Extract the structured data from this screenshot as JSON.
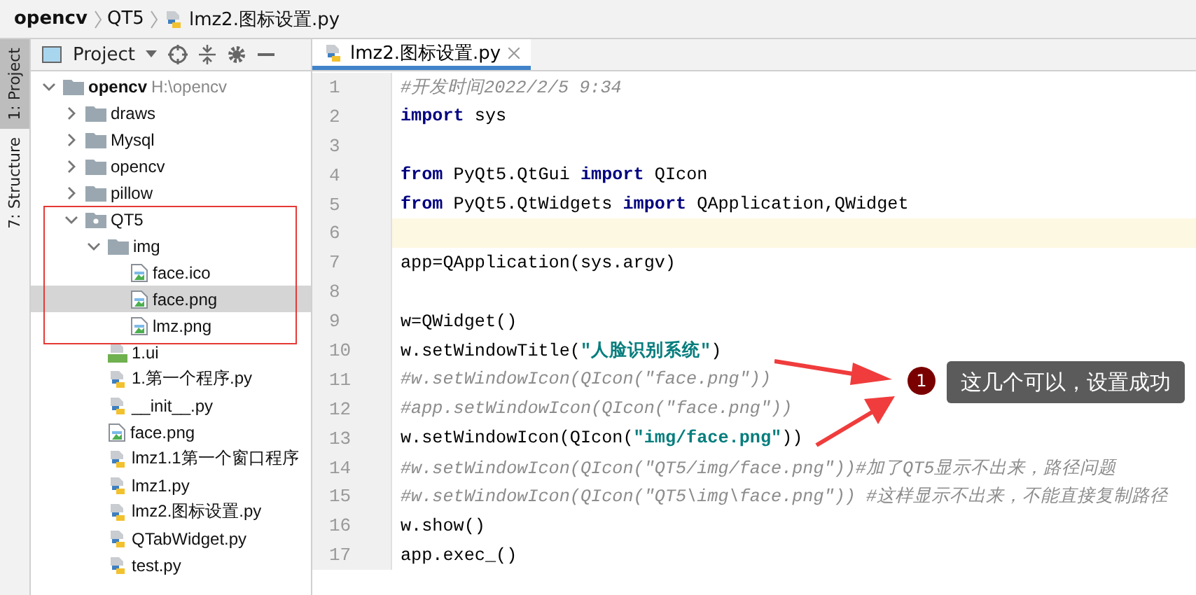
{
  "breadcrumb": [
    {
      "label": "opencv",
      "kind": "project"
    },
    {
      "label": "QT5",
      "kind": "folder"
    },
    {
      "label": "lmz2.图标设置.py",
      "kind": "file"
    }
  ],
  "tool_strip": [
    {
      "label": "1: Project",
      "selected": true
    },
    {
      "label": "7: Structure",
      "selected": false
    }
  ],
  "project_panel": {
    "title": "Project",
    "tree": [
      {
        "label": "opencv",
        "hint": "H:\\opencv",
        "kind": "root",
        "expanded": true,
        "selected": false,
        "children": [
          {
            "label": "draws",
            "kind": "folder",
            "expanded": false,
            "selected": false
          },
          {
            "label": "Mysql",
            "kind": "folder",
            "expanded": false,
            "selected": false
          },
          {
            "label": "opencv",
            "kind": "folder",
            "expanded": false,
            "selected": false
          },
          {
            "label": "pillow",
            "kind": "folder",
            "expanded": false,
            "selected": false
          },
          {
            "label": "QT5",
            "kind": "package",
            "expanded": true,
            "selected": false,
            "children": [
              {
                "label": "img",
                "kind": "folder",
                "expanded": true,
                "selected": false,
                "children": [
                  {
                    "label": "face.ico",
                    "kind": "image",
                    "selected": false
                  },
                  {
                    "label": "face.png",
                    "kind": "image",
                    "selected": true
                  },
                  {
                    "label": "lmz.png",
                    "kind": "image",
                    "selected": false
                  }
                ]
              },
              {
                "label": "1.ui",
                "kind": "ui",
                "selected": false
              },
              {
                "label": "1.第一个程序.py",
                "kind": "py",
                "selected": false
              },
              {
                "label": "__init__.py",
                "kind": "py",
                "selected": false
              },
              {
                "label": "face.png",
                "kind": "image",
                "selected": false
              },
              {
                "label": "lmz1.1第一个窗口程序",
                "kind": "py",
                "selected": false
              },
              {
                "label": "lmz1.py",
                "kind": "py",
                "selected": false
              },
              {
                "label": "lmz2.图标设置.py",
                "kind": "py",
                "selected": false
              },
              {
                "label": "QTabWidget.py",
                "kind": "py",
                "selected": false
              },
              {
                "label": "test.py",
                "kind": "py",
                "selected": false
              }
            ]
          }
        ]
      }
    ]
  },
  "editor": {
    "tabs": [
      {
        "label": "lmz2.图标设置.py",
        "selected": true
      }
    ],
    "lines": [
      {
        "number": "1",
        "current": false,
        "tokens": [
          {
            "kind": "comment",
            "text": "#开发时间2022/2/5 9:34"
          }
        ]
      },
      {
        "number": "2",
        "current": false,
        "tokens": [
          {
            "kind": "keyword",
            "text": "import"
          },
          {
            "kind": "plain",
            "text": " sys"
          }
        ]
      },
      {
        "number": "3",
        "current": false
      },
      {
        "number": "4",
        "current": false,
        "tokens": [
          {
            "kind": "keyword",
            "text": "from"
          },
          {
            "kind": "plain",
            "text": " PyQt5.QtGui "
          },
          {
            "kind": "keyword",
            "text": "import"
          },
          {
            "kind": "plain",
            "text": " QIcon"
          }
        ]
      },
      {
        "number": "5",
        "current": false,
        "tokens": [
          {
            "kind": "keyword",
            "text": "from"
          },
          {
            "kind": "plain",
            "text": " PyQt5.QtWidgets "
          },
          {
            "kind": "keyword",
            "text": "import"
          },
          {
            "kind": "plain",
            "text": " QApplication,QWidget"
          }
        ]
      },
      {
        "number": "6",
        "current": true
      },
      {
        "number": "7",
        "current": false,
        "tokens": [
          {
            "kind": "plain",
            "text": "app=QApplication(sys.argv)"
          }
        ]
      },
      {
        "number": "8",
        "current": false
      },
      {
        "number": "9",
        "current": false,
        "tokens": [
          {
            "kind": "plain",
            "text": "w=QWidget()"
          }
        ]
      },
      {
        "number": "10",
        "current": false,
        "tokens": [
          {
            "kind": "plain",
            "text": "w.setWindowTitle("
          },
          {
            "kind": "string",
            "text": "\"人脸识别系统\""
          },
          {
            "kind": "plain",
            "text": ")"
          }
        ]
      },
      {
        "number": "11",
        "current": false,
        "tokens": [
          {
            "kind": "comment",
            "text": "#w.setWindowIcon(QIcon(\"face.png\"))"
          }
        ]
      },
      {
        "number": "12",
        "current": false,
        "tokens": [
          {
            "kind": "comment",
            "text": "#app.setWindowIcon(QIcon(\"face.png\"))"
          }
        ]
      },
      {
        "number": "13",
        "current": false,
        "tokens": [
          {
            "kind": "plain",
            "text": "w.setWindowIcon(QIcon("
          },
          {
            "kind": "string",
            "text": "\"img/face.png\""
          },
          {
            "kind": "plain",
            "text": "))"
          }
        ]
      },
      {
        "number": "14",
        "current": false,
        "tokens": [
          {
            "kind": "comment",
            "text": "#w.setWindowIcon(QIcon(\"QT5/img/face.png\"))#加了QT5显示不出来，路径问题"
          }
        ]
      },
      {
        "number": "15",
        "current": false,
        "tokens": [
          {
            "kind": "comment",
            "text": "#w.setWindowIcon(QIcon(\"QT5\\img\\face.png\")) #这样显示不出来，不能直接复制路径"
          }
        ]
      },
      {
        "number": "16",
        "current": false,
        "tokens": [
          {
            "kind": "plain",
            "text": "w.show()"
          }
        ]
      },
      {
        "number": "17",
        "current": false,
        "tokens": [
          {
            "kind": "plain",
            "text": "app.exec_()"
          }
        ]
      }
    ]
  },
  "callout": {
    "number": "1",
    "text": "这几个可以，设置成功"
  }
}
